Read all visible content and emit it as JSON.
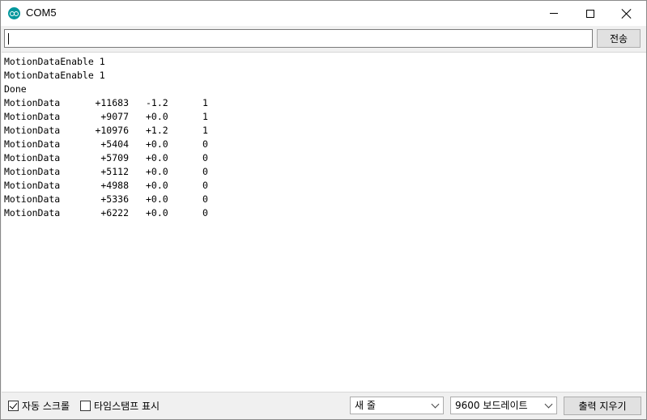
{
  "window": {
    "title": "COM5",
    "controls": {
      "minimize": "minimize-icon",
      "maximize": "maximize-icon",
      "close": "close-icon"
    }
  },
  "input_row": {
    "value": "",
    "placeholder": "",
    "send_label": "전송"
  },
  "output": {
    "lines": [
      "MotionDataEnable 1",
      "MotionDataEnable 1",
      "Done"
    ],
    "rows": [
      {
        "label": "MotionData",
        "value": "+11683",
        "angle": "-1.2",
        "flag": "1"
      },
      {
        "label": "MotionData",
        "value": "+9077",
        "angle": "+0.0",
        "flag": "1"
      },
      {
        "label": "MotionData",
        "value": "+10976",
        "angle": "+1.2",
        "flag": "1"
      },
      {
        "label": "MotionData",
        "value": "+5404",
        "angle": "+0.0",
        "flag": "0"
      },
      {
        "label": "MotionData",
        "value": "+5709",
        "angle": "+0.0",
        "flag": "0"
      },
      {
        "label": "MotionData",
        "value": "+5112",
        "angle": "+0.0",
        "flag": "0"
      },
      {
        "label": "MotionData",
        "value": "+4988",
        "angle": "+0.0",
        "flag": "0"
      },
      {
        "label": "MotionData",
        "value": "+5336",
        "angle": "+0.0",
        "flag": "0"
      },
      {
        "label": "MotionData",
        "value": "+6222",
        "angle": "+0.0",
        "flag": "0"
      }
    ]
  },
  "bottom_bar": {
    "autoscroll_label": "자동 스크롤",
    "autoscroll_checked": true,
    "timestamp_label": "타임스탬프 표시",
    "timestamp_checked": false,
    "line_ending_selected": "새 줄",
    "baud_selected": "9600 보드레이트",
    "clear_label": "출력 지우기"
  },
  "colors": {
    "app_icon": "#00979c",
    "button_bg": "#e1e1e1",
    "window_bg": "#f0f0f0"
  }
}
